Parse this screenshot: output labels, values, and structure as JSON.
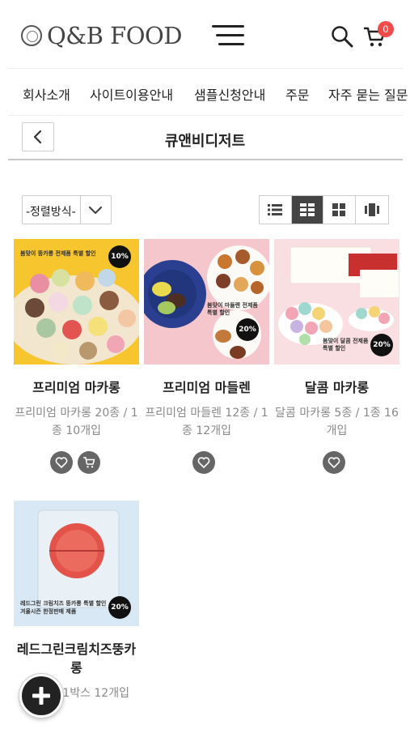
{
  "header": {
    "logo_text": "Q&B FOOD",
    "cart_count": "0"
  },
  "topnav": [
    "회사소개",
    "사이트이용안내",
    "샘플신청안내",
    "주문",
    "자주 묻는 질문"
  ],
  "page": {
    "title": "큐앤비디저트"
  },
  "sort": {
    "label": "-정렬방식-"
  },
  "products": [
    {
      "name": "프리미엄 마카롱",
      "desc": "프리미엄 마카롱 20종 / 1종 10개입",
      "promo": "봄맞이 뚱카롱 전제품 특별 할인",
      "discount": "10%"
    },
    {
      "name": "프리미엄 마들렌",
      "desc": "프리미엄 마들렌 12종 / 1종 12개입",
      "promo": "봄맞이 마들렌 전제품 특별 할인",
      "discount": "20%"
    },
    {
      "name": "달콤 마카롱",
      "desc": "달콤 마카롱 5종 / 1종 16개입",
      "promo": "봄맞이 달콤 전제품 특별 할인",
      "discount": "20%"
    },
    {
      "name": "레드그린크림치즈뚱카롱",
      "desc": "1제품 / 1박스 12개입",
      "promo": "레드그린 크림치즈 뚱카롱 특별 할인 겨울시즌 한정판매 제품",
      "discount": "20%"
    }
  ]
}
